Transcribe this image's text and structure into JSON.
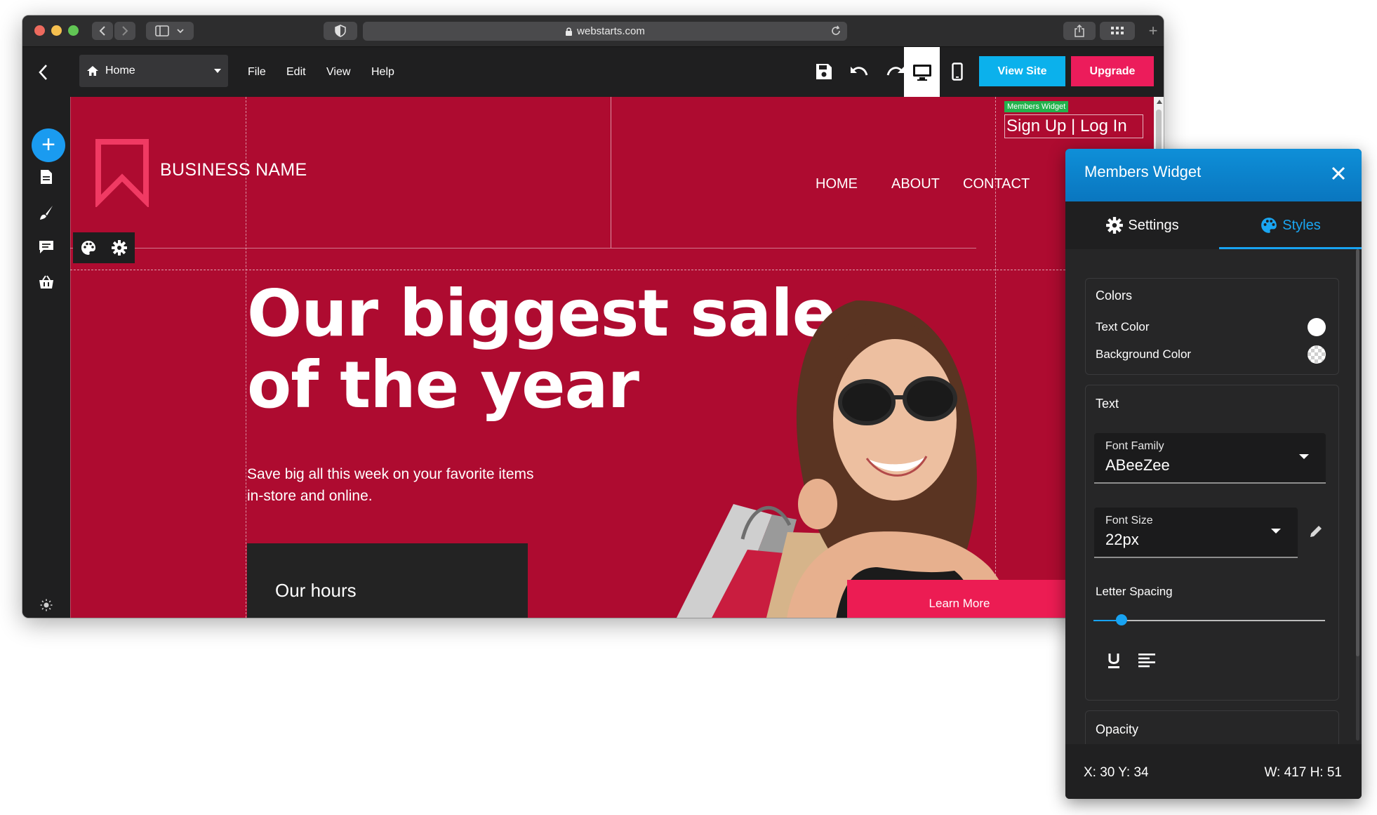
{
  "browser": {
    "url": "webstarts.com",
    "traffic_lights": [
      "#ed6a5e",
      "#f5bf4f",
      "#61c554"
    ]
  },
  "toolbar": {
    "page_select": "Home",
    "menu": [
      "File",
      "Edit",
      "View",
      "Help"
    ],
    "view_site_label": "View Site",
    "upgrade_label": "Upgrade",
    "accent_blue": "#0bb1ec",
    "accent_pink": "#ec1c5b"
  },
  "site": {
    "business_name": "BUSINESS NAME",
    "nav": [
      "HOME",
      "ABOUT",
      "CONTACT"
    ],
    "members_tag": "Members Widget",
    "members_links": "Sign Up  |  Log In",
    "hero_title_line1": "Our biggest sale",
    "hero_title_line2": "of the year",
    "hero_sub_line1": "Save big all this week on your favorite items",
    "hero_sub_line2": "in-store and online.",
    "hours_label": "Our hours",
    "learn_more": "Learn More",
    "background_color": "#ae0b30"
  },
  "panel": {
    "title": "Members Widget",
    "tabs": [
      "Settings",
      "Styles"
    ],
    "active_tab": "Styles",
    "colors_title": "Colors",
    "text_color_label": "Text Color",
    "background_color_label": "Background Color",
    "text_title": "Text",
    "font_family_label": "Font Family",
    "font_family_value": "ABeeZee",
    "font_size_label": "Font Size",
    "font_size_value": "22px",
    "letter_spacing_label": "Letter Spacing",
    "letter_spacing_level": 0.12,
    "opacity_title": "Opacity",
    "footer_xy": "X: 30 Y: 34",
    "footer_wh": "W: 417 H: 51"
  }
}
